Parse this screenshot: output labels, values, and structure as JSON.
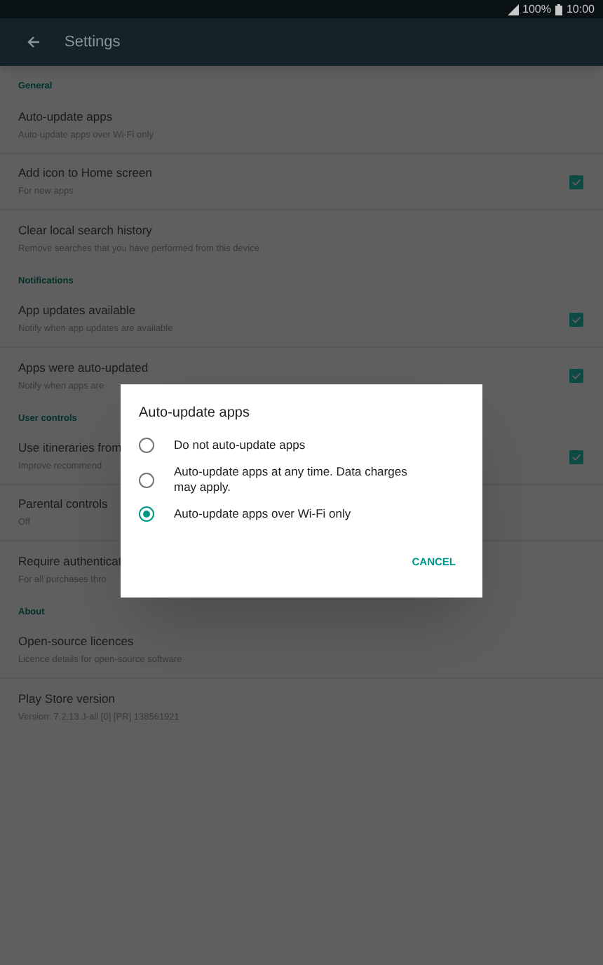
{
  "status_bar": {
    "battery": "100%",
    "time": "10:00"
  },
  "app_bar": {
    "title": "Settings"
  },
  "sections": [
    {
      "title": "General",
      "rows": [
        {
          "kind": "plain",
          "title": "Auto-update apps",
          "subtitle": "Auto-update apps over Wi-Fi only"
        },
        {
          "kind": "checkbox",
          "title": "Add icon to Home screen",
          "subtitle": "For new apps",
          "checked": true
        },
        {
          "kind": "plain",
          "title": "Clear local search history",
          "subtitle": "Remove searches that you have performed from this device"
        }
      ]
    },
    {
      "title": "Notifications",
      "rows": [
        {
          "kind": "checkbox",
          "title": "App updates available",
          "subtitle": "Notify when app updates are available",
          "checked": true
        },
        {
          "kind": "checkbox",
          "title": "Apps were auto-updated",
          "subtitle": "Notify when apps are",
          "checked": true
        }
      ]
    },
    {
      "title": "User controls",
      "rows": [
        {
          "kind": "checkbox",
          "title": "Use itineraries from",
          "subtitle": "Improve recommend",
          "checked": true
        },
        {
          "kind": "plain",
          "title": "Parental controls",
          "subtitle": "Off"
        },
        {
          "kind": "plain",
          "title": "Require authenticat",
          "subtitle": "For all purchases thro"
        }
      ]
    },
    {
      "title": "About",
      "rows": [
        {
          "kind": "plain",
          "title": "Open-source licences",
          "subtitle": "Licence details for open-source software"
        },
        {
          "kind": "plain",
          "title": "Play Store version",
          "subtitle": "Version: 7.2.13.J-all [0] [PR] 138561921"
        }
      ]
    }
  ],
  "dialog": {
    "title": "Auto-update apps",
    "options": [
      {
        "label": "Do not auto-update apps",
        "selected": false
      },
      {
        "label": "Auto-update apps at any time. Data charges may apply.",
        "selected": false
      },
      {
        "label": "Auto-update apps over Wi-Fi only",
        "selected": true
      }
    ],
    "buttons": [
      "CANCEL"
    ]
  }
}
